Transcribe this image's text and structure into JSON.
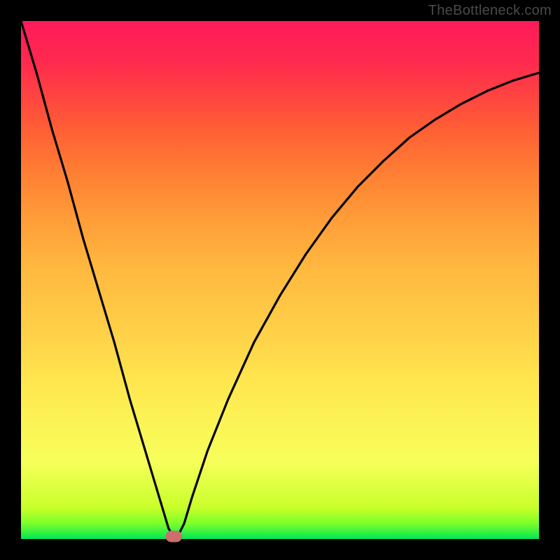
{
  "attribution": "TheBottleneck.com",
  "chart_data": {
    "type": "line",
    "title": "",
    "xlabel": "",
    "ylabel": "",
    "xlim": [
      0,
      100
    ],
    "ylim": [
      0,
      100
    ],
    "grid": false,
    "legend": false,
    "series": [
      {
        "name": "bottleneck-curve",
        "x": [
          0,
          3,
          6,
          9,
          12,
          15,
          18,
          21,
          24,
          27,
          28.5,
          29.5,
          30.5,
          31.5,
          33,
          36,
          40,
          45,
          50,
          55,
          60,
          65,
          70,
          75,
          80,
          85,
          90,
          95,
          100
        ],
        "values": [
          100,
          90,
          79,
          69,
          58,
          48,
          38,
          27,
          17,
          7,
          2,
          0.5,
          1,
          3,
          8,
          17,
          27,
          38,
          47,
          55,
          62,
          68,
          73,
          77.5,
          81,
          84,
          86.5,
          88.5,
          90
        ]
      }
    ],
    "markers": [
      {
        "name": "point-marker",
        "x": 29.5,
        "y": 0.5,
        "radius_pct": 1.1,
        "rx_pct": 1.6,
        "fill": "#cc6f6c"
      }
    ]
  }
}
